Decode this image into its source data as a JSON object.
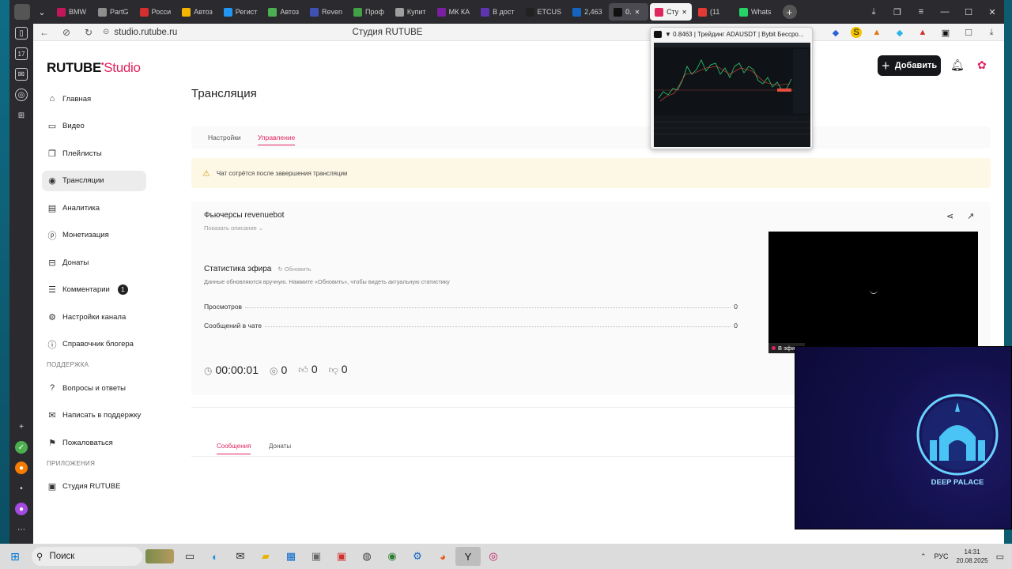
{
  "browser": {
    "tabs": [
      {
        "label": "BMW",
        "color": "#c2185b"
      },
      {
        "label": "PartG",
        "color": "#8e8e8e"
      },
      {
        "label": "Росси",
        "color": "#d32f2f"
      },
      {
        "label": "Автоз",
        "color": "#f5b400"
      },
      {
        "label": "Регист",
        "color": "#2196f3"
      },
      {
        "label": "Автоз",
        "color": "#4caf50"
      },
      {
        "label": "Reven",
        "color": "#3f51b5"
      },
      {
        "label": "Проф",
        "color": "#43a047"
      },
      {
        "label": "Купит",
        "color": "#9e9e9e"
      },
      {
        "label": "МК КА",
        "color": "#7b1fa2"
      },
      {
        "label": "В дост",
        "color": "#5e35b1"
      },
      {
        "label": "ETCUS",
        "color": "#212121"
      },
      {
        "label": "2,463",
        "color": "#1565c0"
      },
      {
        "label": "0.",
        "color": "#111111"
      },
      {
        "label": "Сту",
        "color": "#e0245e"
      },
      {
        "label": "(11",
        "color": "#e53935"
      },
      {
        "label": "Whats",
        "color": "#25d366"
      }
    ],
    "url": "studio.rutube.ru",
    "page_title": "Студия RUTUBE"
  },
  "preview": {
    "title": "▼ 0.8463 | Трейдинг ADAUSDT | Bybit Бессро..."
  },
  "header": {
    "logo_main": "RUTUBE",
    "logo_sub": "Studio",
    "add_label": "Добавить"
  },
  "sidebar": {
    "items": [
      {
        "label": "Главная",
        "icon": "home-icon",
        "glyph": "⌂"
      },
      {
        "label": "Видео",
        "icon": "video-icon",
        "glyph": "▭"
      },
      {
        "label": "Плейлисты",
        "icon": "playlist-icon",
        "glyph": "❐"
      },
      {
        "label": "Трансляции",
        "icon": "broadcast-icon",
        "glyph": "◉"
      },
      {
        "label": "Аналитика",
        "icon": "analytics-icon",
        "glyph": "▤"
      },
      {
        "label": "Монетизация",
        "icon": "monetization-icon",
        "glyph": "ⓟ"
      },
      {
        "label": "Донаты",
        "icon": "donate-icon",
        "glyph": "⊟"
      },
      {
        "label": "Комментарии",
        "icon": "comments-icon",
        "glyph": "☰",
        "badge": "1"
      },
      {
        "label": "Настройки канала",
        "icon": "settings-icon",
        "glyph": "⚙"
      },
      {
        "label": "Справочник блогера",
        "icon": "info-icon",
        "glyph": "ⓘ"
      }
    ],
    "support_title": "ПОДДЕРЖКА",
    "support_items": [
      {
        "label": "Вопросы и ответы",
        "icon": "question-icon",
        "glyph": "?"
      },
      {
        "label": "Написать в поддержку",
        "icon": "mail-icon",
        "glyph": "✉"
      },
      {
        "label": "Пожаловаться",
        "icon": "flag-icon",
        "glyph": "⚑"
      }
    ],
    "apps_title": "ПРИЛОЖЕНИЯ",
    "apps_items": [
      {
        "label": "Студия RUTUBE",
        "icon": "app-icon",
        "glyph": "▣"
      }
    ]
  },
  "main": {
    "title": "Трансляция",
    "tabs": [
      "Настройки",
      "Управление"
    ],
    "warning": "Чат сотрётся после завершения трансляции",
    "stream_title": "Фьючерсы revenuebot",
    "show_description": "Показать описание ⌄",
    "stats_title": "Статистика эфира",
    "refresh": "Обновить",
    "stats_note": "Данные обновляются вручную. Нажмите «Обновить», чтобы видеть актуальную статистику",
    "stats": [
      {
        "label": "Просмотров",
        "value": "0"
      },
      {
        "label": "Сообщений в чате",
        "value": "0"
      }
    ],
    "timer": "00:00:01",
    "viewers": "0",
    "likes": "0",
    "dislikes": "0",
    "live_badge": "В эфире",
    "chat_tabs": [
      "Сообщения",
      "Донаты"
    ]
  },
  "overlay": {
    "label": "DEEP PALACE"
  },
  "taskbar": {
    "search": "Поиск",
    "lang": "РУС",
    "time": "14:31",
    "date": "20.08.2025"
  },
  "colors": {
    "accent": "#e0245e",
    "warning_bg": "#fdf8e6"
  }
}
